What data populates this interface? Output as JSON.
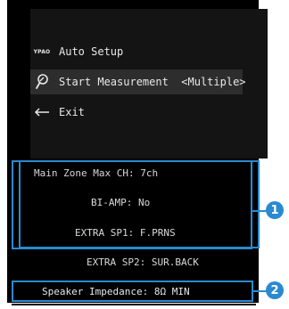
{
  "menu": {
    "brand_mark": "YPAO",
    "title": "Auto Setup",
    "start_label": "Start Measurement  <Multiple>",
    "exit_label": "Exit"
  },
  "info": {
    "main_zone": "Main Zone Max CH: 7ch",
    "bi_amp": "BI-AMP: No",
    "extra_sp1": "EXTRA SP1: F.PRNS",
    "extra_sp2": "EXTRA SP2: SUR.BACK"
  },
  "impedance": {
    "text": "Speaker Impedance: 8Ω MIN"
  },
  "callouts": [
    "1",
    "2"
  ],
  "colors": {
    "accent": "#2a8ad0",
    "screen_bg": "#000000",
    "panel_bg": "#141414",
    "highlight_row": "#2d2d2d"
  },
  "icons": {
    "start": "microphone-icon",
    "exit": "return-arrow-icon"
  }
}
